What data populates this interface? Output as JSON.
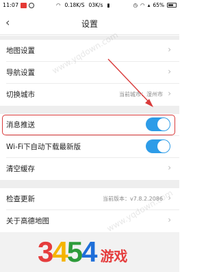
{
  "status_bar": {
    "time": "11:07",
    "network_speed": "0.18K/S",
    "speed2": "03K/s",
    "battery": "65%"
  },
  "header": {
    "title": "设置"
  },
  "settings": {
    "map_settings": "地图设置",
    "nav_settings": "导航设置",
    "switch_city": "切换城市",
    "current_city": "当前城市：湿州市",
    "push_messages": "消息推送",
    "wifi_auto_download": "Wi-Fi下自动下载最新版",
    "clear_cache": "清空缓存",
    "check_update": "检查更新",
    "current_version": "当前版本：v7.8.2.2086",
    "about": "关于高德地图"
  },
  "toggles": {
    "push_messages_on": true,
    "wifi_auto_download_on": true
  },
  "watermark": "www.yqdown.com",
  "logo": {
    "digits": [
      "3",
      "4",
      "5",
      "4"
    ],
    "suffix": "游戏",
    "colors": [
      "#e53d3d",
      "#f5b400",
      "#2e9b3a",
      "#1e6fd9"
    ]
  },
  "colors": {
    "accent": "#2d9ce8",
    "highlight": "#d93a3a",
    "arrow": "#d93a3a"
  }
}
